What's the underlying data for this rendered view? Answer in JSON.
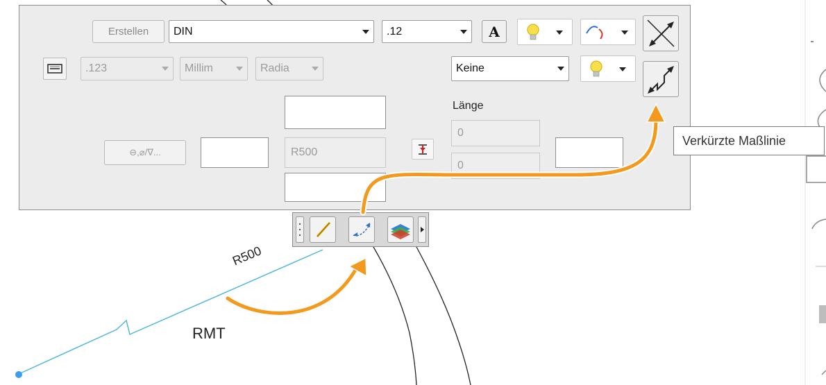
{
  "dimension_panel": {
    "create_button": "Erstellen",
    "standard_combo": "DIN",
    "text_height_combo": ".12",
    "precision_combo": ".123",
    "unit_combo": "Millim",
    "angle_combo": "Radia",
    "terminator_combo": "Keine",
    "symbol_button": "⊖,⌀/∇...",
    "radius_field": "R500",
    "length_label": "Länge",
    "length_value_top": "0",
    "length_value_bottom": "0"
  },
  "tooltip": {
    "text": "Verkürzte Maßlinie"
  },
  "canvas": {
    "dimension_label": "R500",
    "annotation_label": "RMT"
  },
  "colors": {
    "highlight_arrow": "#f39a1e",
    "dimension_line": "#4eb6e0",
    "panel_bg": "#ececec"
  }
}
